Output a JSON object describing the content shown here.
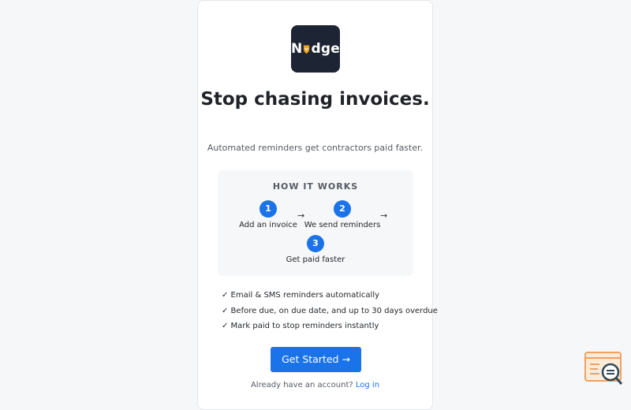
{
  "brand": {
    "logo_left": "N",
    "logo_right": "dge",
    "accent": "#1a73e8",
    "logo_bg": "#1d2433",
    "shield_color": "#f2a31b"
  },
  "hero": {
    "headline": "Stop chasing invoices.",
    "subhead": "Automated reminders get contractors paid faster."
  },
  "how_it_works": {
    "title": "HOW IT WORKS",
    "steps": [
      {
        "number": "1",
        "label": "Add an invoice"
      },
      {
        "number": "2",
        "label": "We send reminders"
      },
      {
        "number": "3",
        "label": "Get paid faster"
      }
    ],
    "arrow": "→"
  },
  "features": [
    "✓ Email & SMS reminders automatically",
    "✓ Before due, on due date, and up to 30 days overdue",
    "✓ Mark paid to stop reminders instantly"
  ],
  "cta": {
    "label": "Get Started →"
  },
  "login": {
    "prompt": "Already have an account?",
    "link": "Log in"
  },
  "icons": {
    "corner": "help-search-icon"
  }
}
